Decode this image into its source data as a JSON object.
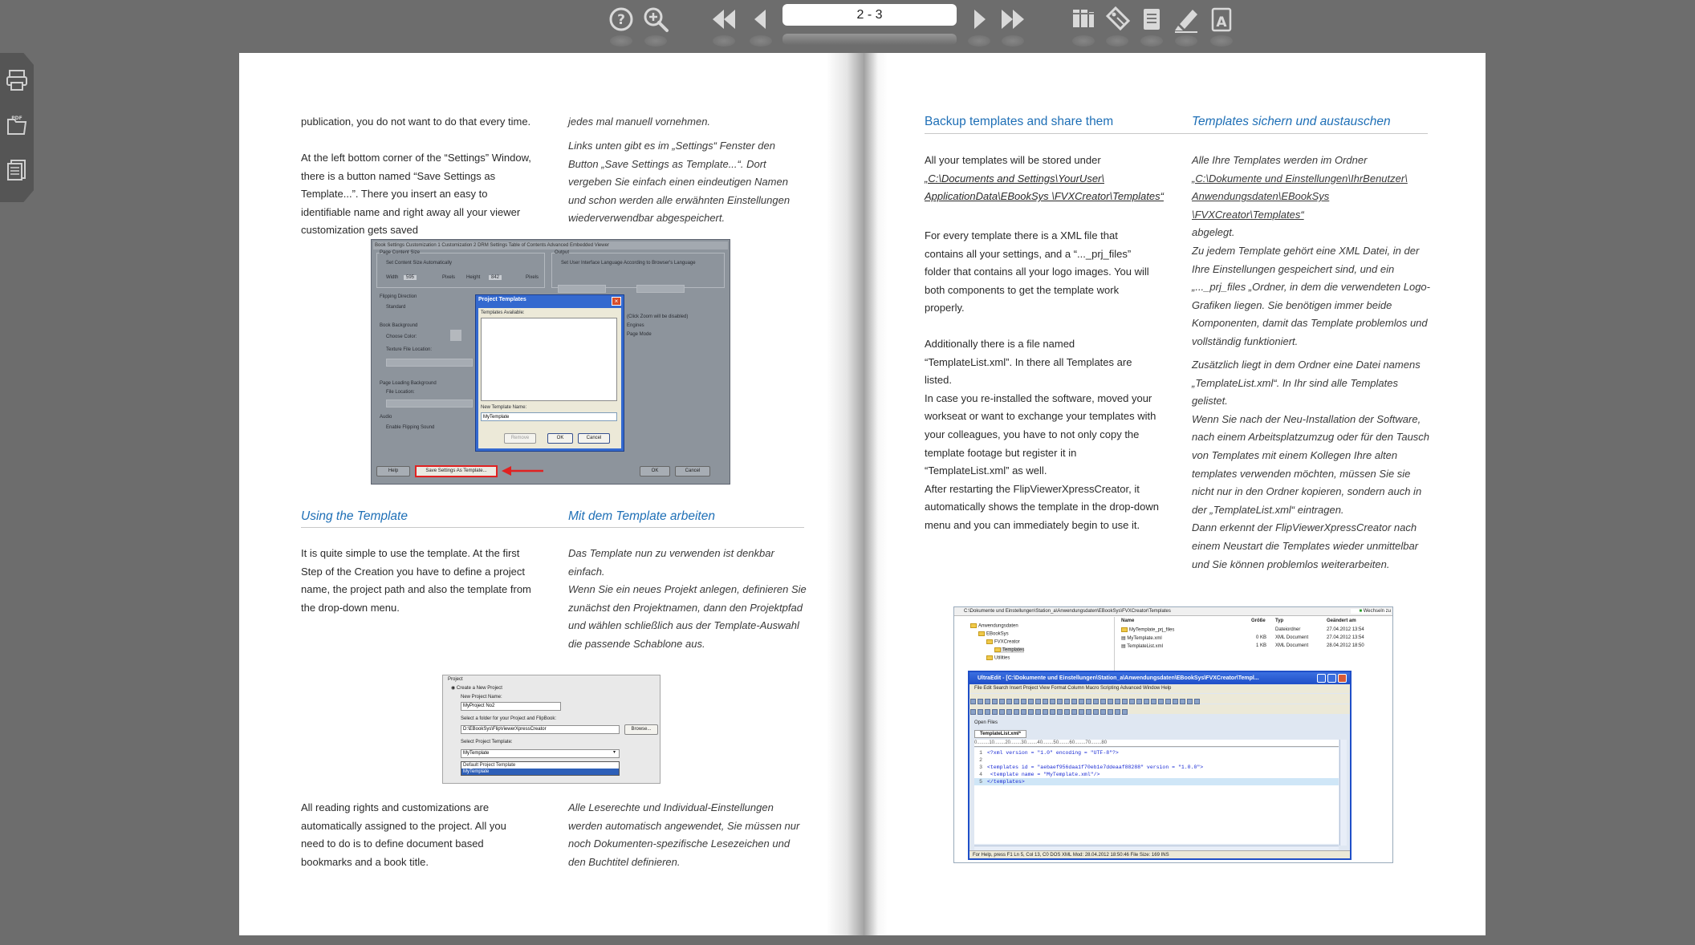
{
  "toolbar": {
    "page_indicator": "2 - 3",
    "buttons": [
      {
        "name": "help-icon"
      },
      {
        "name": "zoom-icon"
      },
      {
        "name": "first-page-icon"
      },
      {
        "name": "previous-page-icon"
      },
      {
        "name": "next-page-icon"
      },
      {
        "name": "last-page-icon"
      },
      {
        "name": "table-of-contents-icon"
      },
      {
        "name": "bookmarks-icon"
      },
      {
        "name": "notes-icon"
      },
      {
        "name": "highlighter-icon"
      },
      {
        "name": "text-search-icon"
      }
    ]
  },
  "sidebar": {
    "items": [
      {
        "name": "print-icon"
      },
      {
        "name": "pdf-download-icon",
        "label": "PDF"
      },
      {
        "name": "thumbnails-icon"
      }
    ]
  },
  "left_page": {
    "en_p1": "publication, you do not want to do that every time.",
    "en_p2": "At the left bottom corner of the “Settings” Window, there is a button named “Save Settings as Template...”. There you insert an easy to identifiable name and right away all your viewer customization gets saved",
    "de_p1": "jedes mal manuell vornehmen.",
    "de_p2": "Links unten gibt es im „Settings“ Fenster den Button „Save Settings as Template...“. Dort vergeben Sie einfach einen eindeutigen Namen und schon werden alle erwähnten Einstellungen wiederverwendbar abgespeichert.",
    "heading_en": "Using the Template",
    "heading_de": "Mit dem Template arbeiten",
    "en_p3": "It is quite simple to use the template. At the first Step of the Creation you have to define a project name, the project path and also the template from the drop-down menu.",
    "de_p3": "Das Template nun zu verwenden ist denkbar einfach.\nWenn Sie ein neues Projekt anlegen, definieren Sie zunächst den Projektnamen, dann den Projektpfad und wählen schließlich aus der Template-Auswahl die passende Schablone aus.",
    "en_p4": "All reading rights and customizations are automatically assigned to the project. All you need to do is to define document based bookmarks and a book title.",
    "de_p4": "Alle Leserechte und Individual-Einstellungen werden automatisch angewendet, Sie müssen nur noch Dokumenten-spezifische Lesezeichen und den Buchtitel definieren."
  },
  "screenshot_settings": {
    "tabs": "Book Settings   Customization 1   Customization 2   DRM Settings   Table of Contents   Advanced   Embedded Viewer",
    "labels": {
      "page_content_size": "Page Content Size",
      "set_content_size": "Set Content Size Automatically",
      "width": "Width",
      "width_val": "595",
      "height": "Height",
      "height_val": "842",
      "pixels": "Pixels",
      "output": "Output",
      "set_user_lang": "Set User Interface Language According to Browser's Language",
      "flipping_direction": "Flipping Direction",
      "standard": "Standard",
      "book_background": "Book Background",
      "choose_color": "Choose Color:",
      "texture_file": "Texture File Location:",
      "page_loading_bg": "Page Loading Background",
      "file_location": "File Location:",
      "audio": "Audio",
      "enable_flipping_sound": "Enable Flipping Sound",
      "engines": "Engines",
      "page_mode": "Page Mode",
      "zoom_disabled": "(Click Zoom will be disabled)",
      "help": "Help",
      "ok": "OK",
      "cancel": "Cancel"
    },
    "dialog": {
      "title": "Project Templates",
      "available": "Templates Available:",
      "new_name_label": "New Template Name:",
      "new_name_value": "MyTemplate",
      "remove": "Remove",
      "ok": "OK",
      "cancel": "Cancel"
    },
    "save_button": "Save Settings As Template..."
  },
  "screenshot_project": {
    "group": "Project",
    "create_new": "Create a New Project",
    "new_project_name": "New Project Name:",
    "project_name_value": "MyProject No2",
    "select_folder": "Select a folder for your Project and FlipBook:",
    "folder_value": "D:\\EBookSys\\FlipViewerXpressCreator",
    "browse": "Browse...",
    "select_template": "Select Project Template:",
    "template_value": "MyTemplate",
    "options": [
      "Default Project Template",
      "MyTemplate"
    ]
  },
  "right_page": {
    "heading_en": "Backup templates and share them",
    "heading_de": "Templates sichern und austauschen",
    "en_p1_intro": "All your templates will be stored under",
    "en_p1_path": "„C:\\Documents and Settings\\YourUser\\ ApplicationData\\EBookSys \\FVXCreator\\Templates“",
    "en_p2": "For every template there is a XML file that contains all your settings, and a “..._prj_files” folder that contains all your logo images. You will both components to get the template work properly.",
    "en_p3": "Additionally there is a file named “TemplateList.xml”. In there all Templates are listed.\nIn case you re-installed the software, moved your workseat or want to exchange your templates with your colleagues, you have to not only copy the template footage but register it in “TemplateList.xml” as well.\nAfter restarting the FlipViewerXpressCreator, it automatically shows the template in the drop-down menu and you can immediately begin to use it.",
    "de_p1_intro": "Alle Ihre Templates werden im Ordner",
    "de_p1_path": "„C:\\Dokumente und Einstellungen\\IhrBenutzer\\ Anwendungsdaten\\EBookSys \\FVXCreator\\Templates“",
    "de_p1_end": "abgelegt.\nZu jedem Template gehört eine XML Datei, in der Ihre Einstellungen gespeichert sind, und ein „..._prj_files „Ordner, in dem die verwendeten Logo-Grafiken liegen. Sie benötigen immer beide Komponenten, damit das Template problemlos und vollständig funktioniert.",
    "de_p2": "Zusätzlich liegt in dem Ordner eine Datei namens „TemplateList.xml“. In Ihr sind alle Templates gelistet.\nWenn Sie nach der Neu-Installation der Software, nach einem Arbeitsplatzumzug oder für den Tausch von Templates mit einem Kollegen Ihre alten templates verwenden möchten, müssen Sie sie nicht nur in den Ordner kopieren, sondern auch in der „TemplateList.xml“ eintragen.\nDann erkennt der FlipViewerXpressCreator nach einem Neustart die Templates wieder unmittelbar und Sie können problemlos weiterarbeiten."
  },
  "screenshot_editor": {
    "explorer_path": "C:\\Dokumente und Einstellungen\\Station_a\\Anwendungsdaten\\EBookSys\\FVXCreator\\Templates",
    "go_label": "Wechseln zu",
    "tree": [
      "Anwendungsdaten",
      "EBookSys",
      "FVXCreator",
      "Templates",
      "Utilities"
    ],
    "columns": [
      "Name",
      "Größe",
      "Typ",
      "Geändert am"
    ],
    "files": [
      {
        "name": "MyTemplate_prj_files",
        "size": "",
        "type": "Dateiordner",
        "date": "27.04.2012 13:54"
      },
      {
        "name": "MyTemplate.xml",
        "size": "0 KB",
        "type": "XML Document",
        "date": "27.04.2012 13:54"
      },
      {
        "name": "TemplateList.xml",
        "size": "1 KB",
        "type": "XML Document",
        "date": "28.04.2012 18:50"
      }
    ],
    "title": "UltraEdit - [C:\\Dokumente und Einstellungen\\Station_a\\Anwendungsdaten\\EBookSys\\FVXCreator\\Templ...",
    "menu": "File   Edit   Search   Insert   Project   View   Format   Column   Macro   Scripting   Advanced   Window   Help",
    "open_files": "Open Files",
    "tab": "TemplateList.xml*",
    "ruler": "0.........10........20........30........40........50........60........70........80",
    "code": [
      {
        "ln": "1",
        "text": "<?xml version = \"1.0\" encoding = \"UTF-8\"?>"
      },
      {
        "ln": "2",
        "text": ""
      },
      {
        "ln": "3",
        "text": "<templates id = \"aebaef956daa1f70eb1e7ddeaaf88288\" version = \"1.0.0\">"
      },
      {
        "ln": "4",
        "text": "    <template name = \"MyTemplate.xml\"/>"
      },
      {
        "ln": "5",
        "text": "</templates>"
      }
    ],
    "status": "For Help, press F1          Ln 5, Col 13, C0          DOS          XML          Mod: 28.04.2012 18:50:46          File Size: 169          INS"
  }
}
